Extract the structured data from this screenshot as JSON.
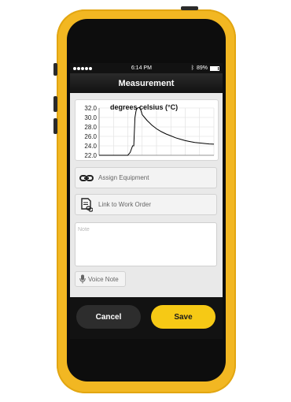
{
  "status_bar": {
    "time": "6:14 PM",
    "battery": "89%",
    "battery_level": 0.89,
    "bluetooth_icon": "bluetooth-icon"
  },
  "nav": {
    "title": "Measurement"
  },
  "chart_data": {
    "type": "line",
    "title": "degrees celsius (°C)",
    "ylim": [
      22.0,
      32.0
    ],
    "yticks": [
      "32.0",
      "30.0",
      "28.0",
      "26.0",
      "24.0",
      "22.0"
    ],
    "grid": true,
    "series": [
      {
        "color": "#000000",
        "points": [
          [
            0,
            22.0
          ],
          [
            1,
            22.0
          ],
          [
            2,
            22.0
          ],
          [
            3,
            22.0
          ],
          [
            4,
            22.0
          ],
          [
            5,
            22.0
          ],
          [
            6,
            22.0
          ],
          [
            7,
            22.0
          ],
          [
            8,
            22.0
          ],
          [
            9,
            22.0
          ],
          [
            10,
            22.0
          ],
          [
            11,
            22.0
          ],
          [
            12,
            22.0
          ],
          [
            13,
            22.6
          ],
          [
            14,
            24.0
          ],
          [
            14.5,
            24.0
          ],
          [
            15,
            30.0
          ],
          [
            15.5,
            31.5
          ],
          [
            16,
            32.0
          ],
          [
            16.8,
            32.1
          ],
          [
            17.5,
            31.5
          ],
          [
            18,
            30.6
          ],
          [
            19,
            30.0
          ],
          [
            20,
            29.4
          ],
          [
            21,
            28.9
          ],
          [
            22,
            28.4
          ],
          [
            23,
            28.0
          ],
          [
            24,
            27.6
          ],
          [
            25,
            27.3
          ],
          [
            26,
            27.0
          ],
          [
            28,
            26.5
          ],
          [
            30,
            26.1
          ],
          [
            32,
            25.7
          ],
          [
            34,
            25.4
          ],
          [
            36,
            25.1
          ],
          [
            38,
            24.9
          ],
          [
            40,
            24.7
          ],
          [
            42,
            24.6
          ],
          [
            44,
            24.5
          ],
          [
            46,
            24.4
          ],
          [
            48,
            24.35
          ]
        ]
      }
    ]
  },
  "actions": {
    "assign_equipment": "Assign Equipment",
    "assign_icon": "link-icon",
    "link_work_order": "Link to Work Order",
    "work_order_icon": "document-link-icon"
  },
  "note": {
    "placeholder": "Note",
    "value": ""
  },
  "voice_note": {
    "label": "Voice Note",
    "icon": "microphone-icon"
  },
  "buttons": {
    "cancel": "Cancel",
    "save": "Save"
  },
  "colors": {
    "phone_case": "#f2b722",
    "save_button": "#f6c915",
    "cancel_button": "#2d2d2d"
  }
}
